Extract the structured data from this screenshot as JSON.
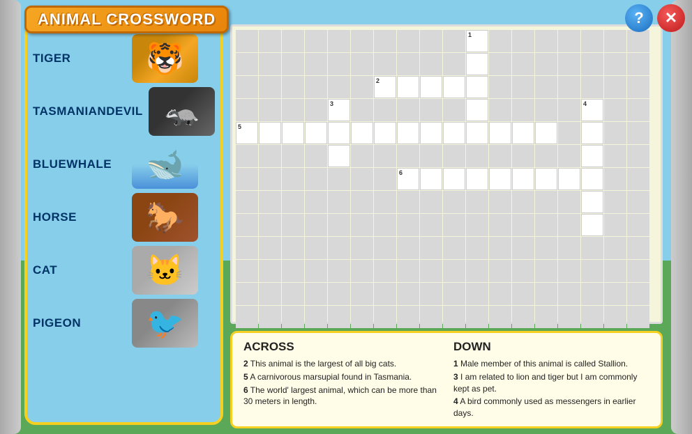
{
  "title": "ANIMAL CROSSWORD",
  "controls": {
    "help_label": "?",
    "close_label": "✕"
  },
  "animals": [
    {
      "id": "tiger",
      "label": "TIGER",
      "img_class": "img-tiger"
    },
    {
      "id": "tasdevil",
      "label": "TASMANIANDEVIL",
      "img_class": "img-tasdevil"
    },
    {
      "id": "bluewhale",
      "label": "BLUEWHALE",
      "img_class": "img-whale"
    },
    {
      "id": "horse",
      "label": "HORSE",
      "img_class": "img-horse"
    },
    {
      "id": "cat",
      "label": "CAT",
      "img_class": "img-cat"
    },
    {
      "id": "pigeon",
      "label": "PIGEON",
      "img_class": "img-pigeon"
    }
  ],
  "clues": {
    "across_title": "ACROSS",
    "across_items": [
      {
        "num": "2",
        "text": "This animal is the largest of all big cats."
      },
      {
        "num": "5",
        "text": "A carnivorous marsupial found in Tasmania."
      },
      {
        "num": "6",
        "text": "The world' largest animal, which can be more than 30 meters in length."
      }
    ],
    "down_title": "DOWN",
    "down_items": [
      {
        "num": "1",
        "text": "Male member of this animal is called Stallion."
      },
      {
        "num": "3",
        "text": "I am related to lion and tiger but I am commonly kept as pet."
      },
      {
        "num": "4",
        "text": "A bird commonly used as messengers in earlier days."
      }
    ]
  }
}
